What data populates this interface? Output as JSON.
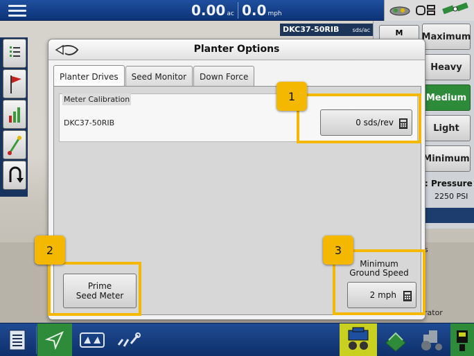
{
  "topbar": {
    "area_value": "0.00",
    "area_unit": "ac",
    "speed_value": "0.0",
    "speed_unit": "mph"
  },
  "background": {
    "hybrid_tag": "DKC37-50RIB",
    "hybrid_tag_unit": "sds/ac",
    "rate_buttons": [
      "Maximum",
      "Heavy",
      "Medium",
      "Light",
      "Minimum"
    ],
    "active_rate": "Medium",
    "m_button": "M",
    "pressure_label": ": Pressure",
    "pressure_value": "2250 PSI",
    "partial_text_1": "s",
    "partial_text_2": "rator"
  },
  "dialog": {
    "title": "Planter Options",
    "tabs": [
      {
        "label": "Planter Drives",
        "active": true
      },
      {
        "label": "Seed Monitor",
        "active": false
      },
      {
        "label": "Down Force",
        "active": false
      }
    ],
    "meter_calibration": {
      "legend": "Meter Calibration",
      "hybrid": "DKC37-50RIB",
      "value": "0 sds/rev"
    },
    "prime_button": {
      "line1": "Prime",
      "line2": "Seed Meter"
    },
    "min_ground_speed": {
      "line1": "Minimum",
      "line2": "Ground Speed",
      "value": "2 mph"
    }
  },
  "callouts": [
    "1",
    "2",
    "3"
  ],
  "colors": {
    "accent_blue": "#1e4f9e",
    "callout_yellow": "#f5b800",
    "active_green": "#2e8b3a"
  },
  "icons": {
    "top_left": "menu-icon",
    "dialog_back": "back-arrow-icon",
    "calculator": "calculator-icon",
    "bottom": [
      "document-icon",
      "guidance-arrow-icon",
      "field-map-icon",
      "implement-wrench-icon",
      "planter-icon",
      "layers-icon",
      "tractor-icon",
      "display-icon"
    ]
  }
}
